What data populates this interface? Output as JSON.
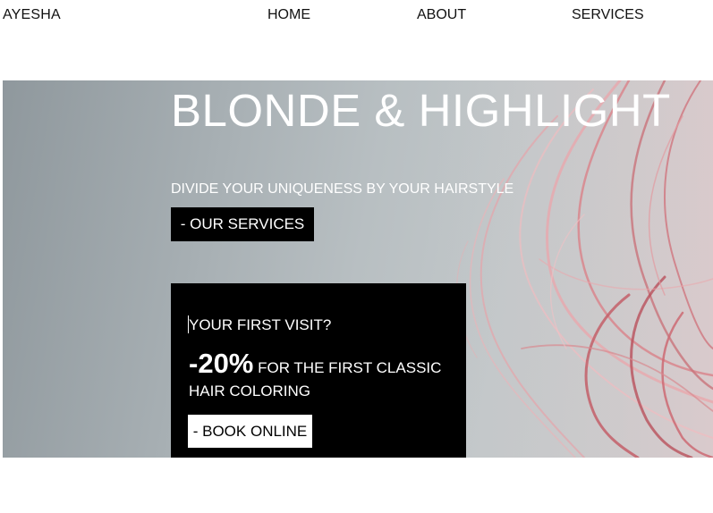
{
  "header": {
    "brand": "AYESHA",
    "nav": {
      "home": "HOME",
      "about": "ABOUT",
      "services": "SERVICES"
    }
  },
  "hero": {
    "title": "BLONDE & HIGHLIGHT",
    "subtitle": "DIVIDE YOUR UNIQUENESS BY YOUR HAIRSTYLE",
    "services_button": "- OUR SERVICES",
    "background_image": "pink-hair-strands",
    "promo": {
      "question": "YOUR FIRST VISIT?",
      "percent": "-20%",
      "offer_text": "FOR THE FIRST CLASSIC HAIR COLORING",
      "book_button": "- BOOK ONLINE"
    }
  },
  "colors": {
    "hero_gray": "#a8b0b4",
    "hair_pink": "#d98a90",
    "box_black": "#000000"
  }
}
